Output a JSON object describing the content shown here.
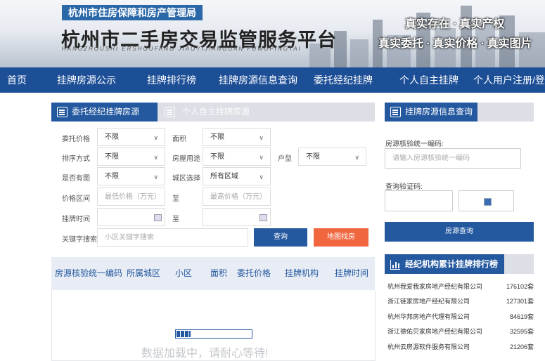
{
  "header": {
    "bureau": "杭州市住房保障和房产管理局",
    "title": "杭州市二手房交易监管服务平台",
    "pinyin": "HANGZHOUSHI  ERSHOUFANG  JIAOYIJIANGUAN  FUWUPINGTAI",
    "slogan1": "真实存在 · 真实产权",
    "slogan2": "真实委托 · 真实价格 · 真实图片"
  },
  "nav": [
    "首页",
    "挂牌房源公示",
    "挂牌排行榜",
    "挂牌房源信息查询",
    "委托经纪挂牌",
    "个人自主挂牌",
    "个人用户注册/登录"
  ],
  "tabs": {
    "active": "委托经纪挂牌房源",
    "inactive": "个人自主挂牌房源"
  },
  "filters": {
    "price_label": "委托价格",
    "price_value": "不限",
    "area_label": "面积",
    "area_value": "不限",
    "sort_label": "排序方式",
    "sort_value": "不限",
    "usage_label": "房屋用途",
    "usage_value": "不限",
    "layout_label": "户型",
    "layout_value": "不限",
    "photo_label": "是否有图",
    "photo_value": "不限",
    "district_label": "城区选择",
    "district_value": "所有区域",
    "range_label": "价格区间",
    "min_placeholder": "最低价格（万元）",
    "to1": "至",
    "max_placeholder": "最高价格（万元）",
    "time_label": "挂牌时间",
    "to2": "至",
    "keyword_label": "关键字搜索",
    "keyword_placeholder": "小区关键字搜索",
    "query_btn": "查询",
    "map_btn": "地图找房"
  },
  "table": {
    "headers": [
      "房源核验统一编码",
      "所属城区",
      "小区",
      "面积",
      "委托价格",
      "挂牌机构",
      "挂牌时间"
    ],
    "loading": "数据加载中，请耐心等待!"
  },
  "colors": {
    "nav": "#1d4f97",
    "tab_active": "#24589f",
    "map_btn": "#f0663f"
  },
  "right": {
    "panel_title": "挂牌房源信息查询",
    "code_label": "房源核验统一编码:",
    "code_placeholder": "请输入房源核验统一编码",
    "verify_label": "查询验证码:",
    "search_btn": "房源查询",
    "rank_title": "经纪机构累计挂牌排行榜",
    "ranking": [
      {
        "name": "杭州我爱我家房地产经纪有限公司",
        "count": "176102套"
      },
      {
        "name": "浙江链家房地产经纪有限公司",
        "count": "127301套"
      },
      {
        "name": "杭州华邦房地产代理有限公司",
        "count": "84619套"
      },
      {
        "name": "浙江德佑贝家房地产经纪有限公司",
        "count": "32595套"
      },
      {
        "name": "杭州云房源软件服务有限公司",
        "count": "21206套"
      }
    ]
  }
}
